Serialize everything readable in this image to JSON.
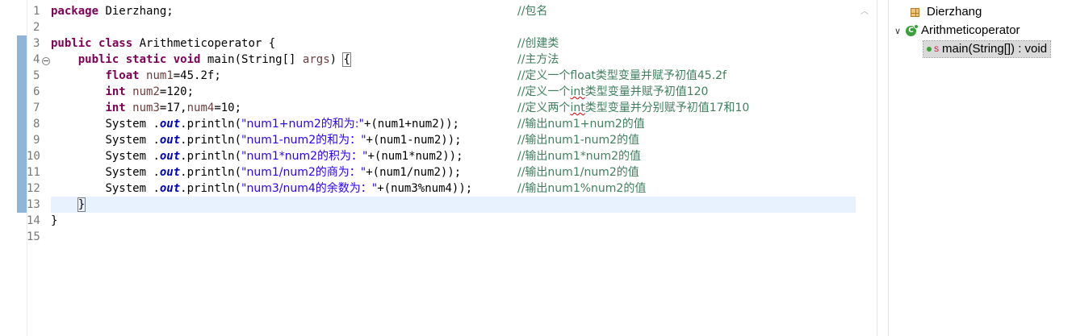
{
  "editor": {
    "line_numbers": [
      "1",
      "2",
      "3",
      "4",
      "5",
      "6",
      "7",
      "8",
      "9",
      "10",
      "11",
      "12",
      "13",
      "14",
      "15"
    ],
    "lines": {
      "l1": {
        "kw": "package",
        "text": " Dierzhang;",
        "comment": "//包名"
      },
      "l3": {
        "kw1": "public",
        "kw2": "class",
        "text": " Arithmeticoperator {",
        "comment": "//创建类"
      },
      "l4": {
        "kw1": "public",
        "kw2": "static",
        "kw3": "void",
        "text1": " main(String[] ",
        "var": "args",
        "text2": ") ",
        "brace": "{",
        "comment": "//主方法"
      },
      "l5": {
        "kw": "float",
        "var": "num1",
        "text": "=45.2f;",
        "comment": "//定义一个float类型变量并赋予初值45.2f"
      },
      "l6": {
        "kw": "int",
        "var": "num2",
        "text": "=120;",
        "comment_a": "//定义一个",
        "comment_err": "int",
        "comment_b": "类型变量并赋予初值120"
      },
      "l7": {
        "kw": "int",
        "var1": "num3",
        "text1": "=17,",
        "var2": "num4",
        "text2": "=10;",
        "comment_a": "//定义两个",
        "comment_err": "int",
        "comment_b": "类型变量并分别赋予初值17和10"
      },
      "l8": {
        "pre": "System .",
        "field": "out",
        "mid": ".println(",
        "str": "\"num1+num2的和为:\"",
        "rest": "+(num1+num2));",
        "comment": "//输出num1+num2的值"
      },
      "l9": {
        "pre": "System .",
        "field": "out",
        "mid": ".println(",
        "str": "\"num1-num2的和为：\"",
        "rest": "+(num1-num2));",
        "comment": "//输出num1-num2的值"
      },
      "l10": {
        "pre": "System .",
        "field": "out",
        "mid": ".println(",
        "str": "\"num1*num2的积为：\"",
        "rest": "+(num1*num2));",
        "comment": "//输出num1*num2的值"
      },
      "l11": {
        "pre": "System .",
        "field": "out",
        "mid": ".println(",
        "str": "\"num1/num2的商为：\"",
        "rest": "+(num1/num2));",
        "comment": "//输出num1/num2的值"
      },
      "l12": {
        "pre": "System .",
        "field": "out",
        "mid": ".println(",
        "str": "\"num3/num4的余数为：\"",
        "rest": "+(num3%num4));",
        "comment": "//输出num1%num2的值"
      },
      "l13": {
        "text": "}"
      },
      "l14": {
        "text": "}"
      }
    }
  },
  "outline": {
    "package": "Dierzhang",
    "class": "Arithmeticoperator",
    "class_icon_letter": "C",
    "method": "main(String[]) : void",
    "static_mark": "S"
  },
  "colors": {
    "keyword": "#7f0055",
    "string": "#2a00ff",
    "comment": "#3f7f5f",
    "field": "#0000c0",
    "current_line": "#e8f2fe",
    "change_bar": "#8fb6d8"
  }
}
